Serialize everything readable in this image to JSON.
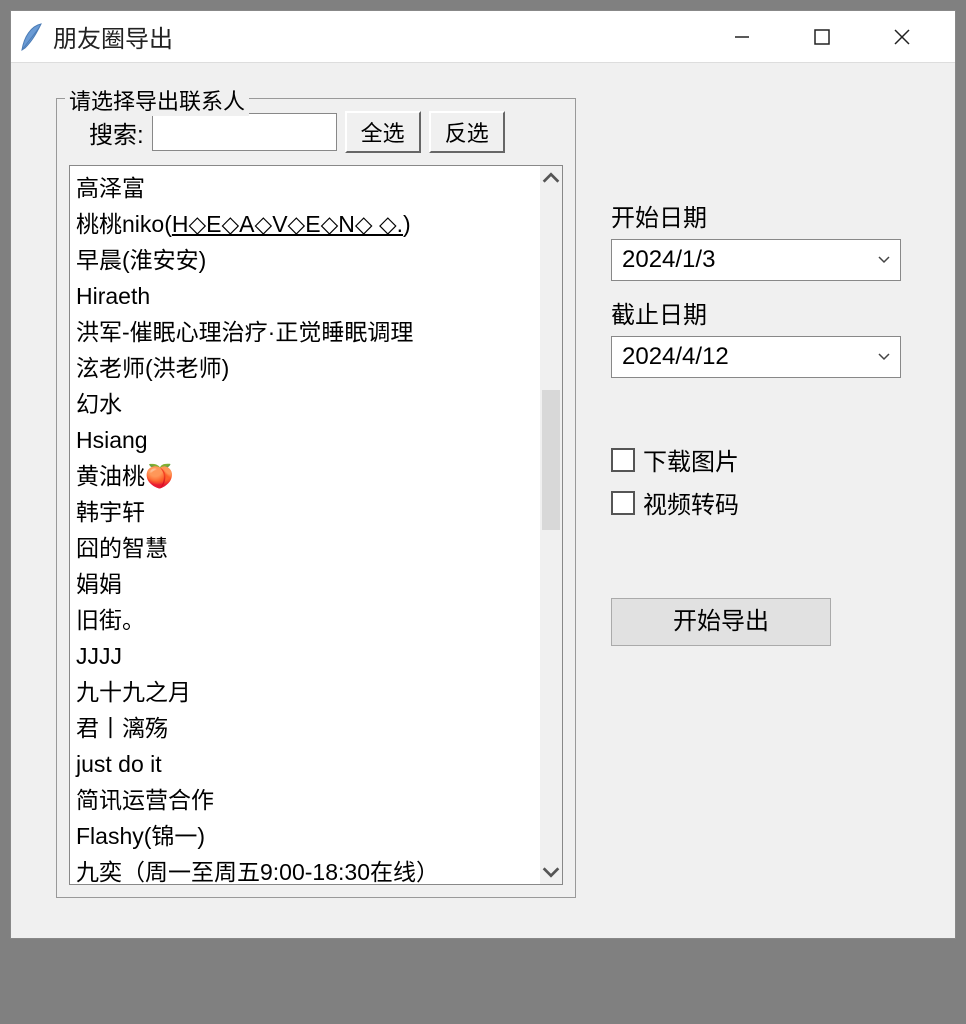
{
  "window": {
    "title": "朋友圈导出"
  },
  "contacts_panel": {
    "legend": "请选择导出联系人",
    "search_label": "搜索:",
    "search_value": "",
    "select_all": "全选",
    "invert_select": "反选",
    "items": [
      "高泽富",
      "桃桃niko(H◇E◇A◇V◇E◇N◇ ◇.)",
      "早晨(淮安安)",
      "Hiraeth",
      "洪军-催眠心理治疗·正觉睡眠调理",
      "泫老师(洪老师)",
      "幻水",
      "Hsiang",
      "黄油桃🍑",
      "韩宇轩",
      "囧的智慧",
      "娟娟",
      "旧街。",
      "JJJJ",
      "九十九之月",
      "君丨漓殇",
      "just do it",
      "简讯运营合作",
      "Flashy(锦一)",
      "九奕（周一至周五9:00-18:30在线）"
    ]
  },
  "dates": {
    "start_label": "开始日期",
    "start_value": "2024/1/3",
    "end_label": "截止日期",
    "end_value": "2024/4/12"
  },
  "options": {
    "download_images": "下载图片",
    "video_transcode": "视频转码"
  },
  "actions": {
    "export": "开始导出"
  }
}
